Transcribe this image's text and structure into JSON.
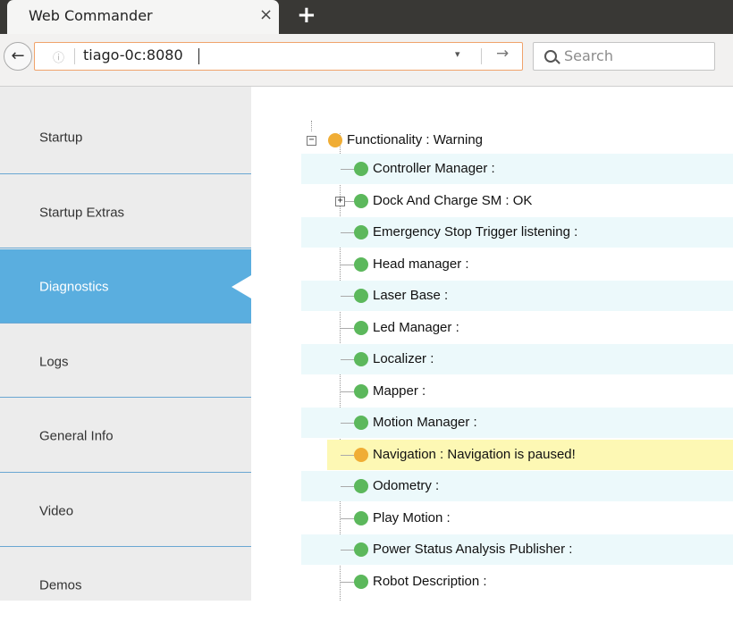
{
  "browser": {
    "tab_title": "Web Commander",
    "tab_close": "×",
    "new_tab": "+",
    "url": "tiago-0c:8080",
    "search_placeholder": "Search",
    "back_glyph": "←",
    "go_glyph": "→",
    "dropdown_glyph": "▾",
    "info_glyph": "ⓘ"
  },
  "sidebar": {
    "items": [
      {
        "label": "Startup",
        "active": false
      },
      {
        "label": "Startup Extras",
        "active": false
      },
      {
        "label": "Diagnostics",
        "active": true
      },
      {
        "label": "Logs",
        "active": false
      },
      {
        "label": "General Info",
        "active": false
      },
      {
        "label": "Video",
        "active": false
      },
      {
        "label": "Demos",
        "active": false
      }
    ]
  },
  "colors": {
    "ok": "#5cb85c",
    "warning": "#f0ad35",
    "sidebar_active": "#5aaedf",
    "warning_row": "#fdf8b4",
    "alt_row": "#ecf9fb"
  },
  "diagnostics": {
    "root": {
      "label": "Functionality : Warning",
      "status": "warning",
      "expanded": true
    },
    "children": [
      {
        "label": "Controller Manager :",
        "status": "ok",
        "expandable": false
      },
      {
        "label": "Dock And Charge SM : OK",
        "status": "ok",
        "expandable": true
      },
      {
        "label": "Emergency Stop Trigger listening :",
        "status": "ok",
        "expandable": false
      },
      {
        "label": "Head manager :",
        "status": "ok",
        "expandable": false
      },
      {
        "label": "Laser Base :",
        "status": "ok",
        "expandable": false
      },
      {
        "label": "Led Manager :",
        "status": "ok",
        "expandable": false
      },
      {
        "label": "Localizer :",
        "status": "ok",
        "expandable": false
      },
      {
        "label": "Mapper :",
        "status": "ok",
        "expandable": false
      },
      {
        "label": "Motion Manager :",
        "status": "ok",
        "expandable": false
      },
      {
        "label": "Navigation : Navigation is paused!",
        "status": "warning",
        "expandable": false
      },
      {
        "label": "Odometry :",
        "status": "ok",
        "expandable": false
      },
      {
        "label": "Play Motion :",
        "status": "ok",
        "expandable": false
      },
      {
        "label": "Power Status Analysis Publisher :",
        "status": "ok",
        "expandable": false
      },
      {
        "label": "Robot Description :",
        "status": "ok",
        "expandable": false
      }
    ]
  }
}
